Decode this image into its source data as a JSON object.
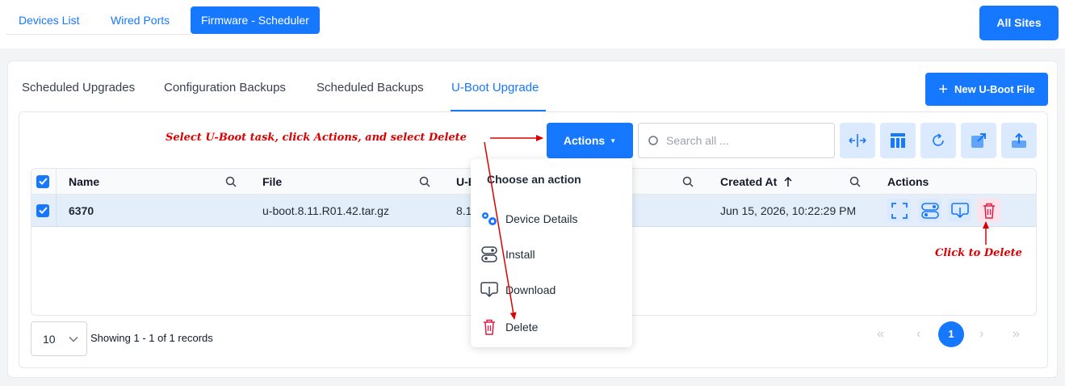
{
  "top_tabs": [
    {
      "label": "Devices List"
    },
    {
      "label": "Wired Ports"
    },
    {
      "label": "Firmware - Scheduler"
    }
  ],
  "all_sites_label": "All Sites",
  "sub_tabs": [
    {
      "label": "Scheduled Upgrades"
    },
    {
      "label": "Configuration Backups"
    },
    {
      "label": "Scheduled Backups"
    },
    {
      "label": "U-Boot Upgrade"
    }
  ],
  "new_file_label": "New U-Boot File",
  "toolbar": {
    "actions_label": "Actions",
    "search_placeholder": "Search all ..."
  },
  "table": {
    "headers": {
      "name": "Name",
      "file": "File",
      "uboot": "U-B",
      "created": "Created At",
      "actions": "Actions"
    },
    "rows": [
      {
        "name": "6370",
        "file": "u-boot.8.11.R01.42.tar.gz",
        "uboot": "8.1",
        "created": "Jun 15, 2026, 10:22:29 PM"
      }
    ]
  },
  "footer": {
    "page_size": "10",
    "showing": "Showing 1 - 1 of 1 records",
    "current_page": "1"
  },
  "dropdown": {
    "title": "Choose an action",
    "items": [
      {
        "label": "Device Details",
        "icon": "gears-icon"
      },
      {
        "label": "Install",
        "icon": "toggle-icon"
      },
      {
        "label": "Download",
        "icon": "download-icon"
      },
      {
        "label": "Delete",
        "icon": "trash-icon"
      }
    ]
  },
  "annotations": {
    "instruction": "Select U-Boot task, click Actions, and select Delete",
    "click_delete": "Click to Delete"
  },
  "colors": {
    "accent": "#1677ff",
    "annotation": "#dc0000",
    "delete": "#e11d48"
  }
}
